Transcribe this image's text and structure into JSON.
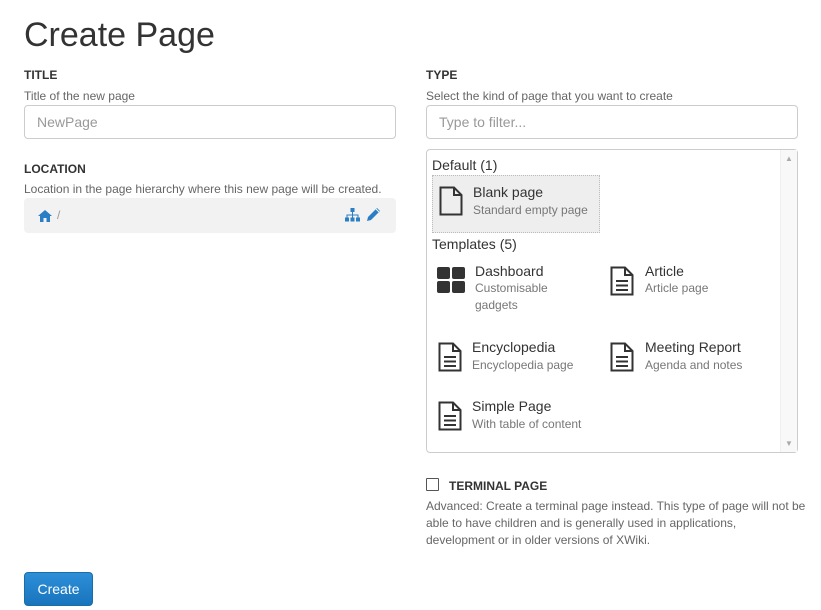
{
  "page": {
    "title": "Create Page"
  },
  "title_field": {
    "label": "TITLE",
    "hint": "Title of the new page",
    "placeholder": "NewPage"
  },
  "location": {
    "label": "LOCATION",
    "hint": "Location in the page hierarchy where this new page will be created.",
    "separator": "/",
    "icons": [
      "home-icon",
      "sitemap-icon",
      "pencil-icon"
    ]
  },
  "type": {
    "label": "TYPE",
    "hint": "Select the kind of page that you want to create",
    "filter_placeholder": "Type to filter...",
    "groups": [
      {
        "title": "Default (1)",
        "items": [
          {
            "name": "Blank page",
            "description": "Standard empty page",
            "icon": "blank-page-icon",
            "selected": true
          }
        ]
      },
      {
        "title": "Templates (5)",
        "items": [
          {
            "name": "Dashboard",
            "description": "Customisable gadgets",
            "icon": "dashboard-icon"
          },
          {
            "name": "Article",
            "description": "Article page",
            "icon": "document-icon"
          },
          {
            "name": "Encyclopedia",
            "description": "Encyclopedia page",
            "icon": "document-icon"
          },
          {
            "name": "Meeting Report",
            "description": "Agenda and notes",
            "icon": "document-icon"
          },
          {
            "name": "Simple Page",
            "description": "With table of content",
            "icon": "document-icon"
          }
        ]
      }
    ]
  },
  "terminal": {
    "label": "TERMINAL PAGE",
    "checked": false,
    "hint": "Advanced: Create a terminal page instead. This type of page will not be able to have children and is generally used in applications, development or in older versions of XWiki."
  },
  "actions": {
    "create_label": "Create"
  },
  "colors": {
    "link": "#2a7ec4",
    "button": "#1f7dc8",
    "icon": "#333333"
  }
}
